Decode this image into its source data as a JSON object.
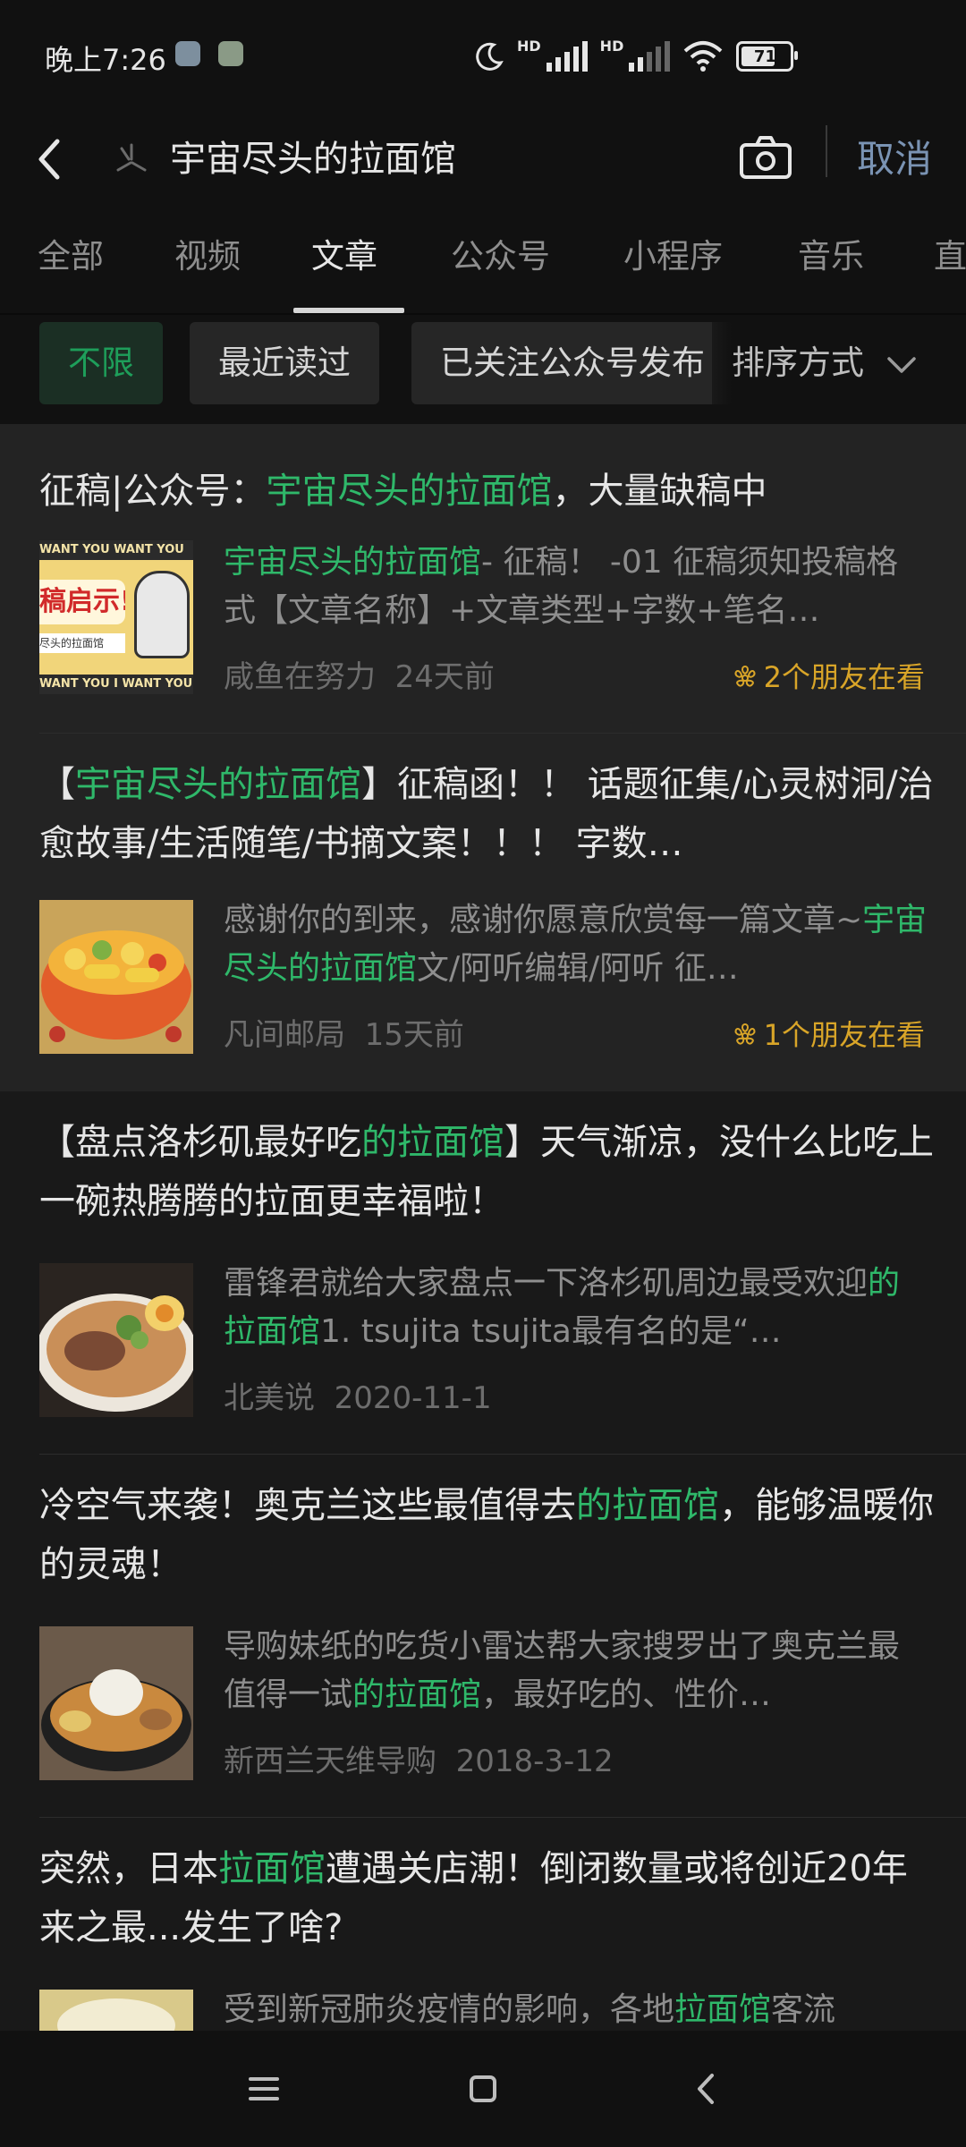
{
  "status_bar": {
    "time": "晚上7:26",
    "battery": "71",
    "battery_level": 0.71,
    "net_label": "HD"
  },
  "search": {
    "query": "宇宙尽头的拉面馆",
    "cancel": "取消"
  },
  "tabs": [
    "全部",
    "视频",
    "文章",
    "公众号",
    "小程序",
    "音乐",
    "直"
  ],
  "active_tab": "文章",
  "filters": {
    "chips": [
      "不限",
      "最近读过",
      "已关注公众号发布"
    ],
    "sort": "排序方式"
  },
  "articles": [
    {
      "title_parts": [
        {
          "t": "征稿|公众号：",
          "hl": false
        },
        {
          "t": "宇宙尽头的拉面馆",
          "hl": true
        },
        {
          "t": "，大量缺稿中",
          "hl": false
        }
      ],
      "snippet_parts": [
        {
          "t": "宇宙尽头的拉面馆",
          "hl": true
        },
        {
          "t": "- 征稿！ -01 征稿须知投稿格式【文章名称】+文章类型+字数+笔名…",
          "hl": false
        }
      ],
      "source": "咸鱼在努力",
      "time": "24天前",
      "friends": "2个朋友在看",
      "thumb_texts": [
        "WANT YOU  WANT YOU",
        "稿启示!",
        "尽头的拉面馆",
        "WANT YOU  I WANT YOU"
      ]
    },
    {
      "title_parts": [
        {
          "t": "【",
          "hl": false
        },
        {
          "t": "宇宙尽头的拉面馆",
          "hl": true
        },
        {
          "t": "】征稿函！！ 话题征集/心灵树洞/治愈故事/生活随笔/书摘文案！！！ 字数…",
          "hl": false
        }
      ],
      "snippet_parts": [
        {
          "t": "感谢你的到来，感谢你愿意欣赏每一篇文章~",
          "hl": false
        },
        {
          "t": "宇宙尽头的拉面馆",
          "hl": true
        },
        {
          "t": "文/阿听编辑/阿听 征…",
          "hl": false
        }
      ],
      "source": "凡间邮局",
      "time": "15天前",
      "friends": "1个朋友在看"
    },
    {
      "title_parts": [
        {
          "t": "【盘点洛杉矶最好吃",
          "hl": false
        },
        {
          "t": "的拉面馆",
          "hl": true
        },
        {
          "t": "】天气渐凉，没什么比吃上一碗热腾腾的拉面更幸福啦！",
          "hl": false
        }
      ],
      "snippet_parts": [
        {
          "t": "雷锋君就给大家盘点一下洛杉矶周边最受欢迎",
          "hl": false
        },
        {
          "t": "的拉面馆",
          "hl": true
        },
        {
          "t": "1. tsujita tsujita最有名的是“…",
          "hl": false
        }
      ],
      "source": "北美说",
      "time": "2020-11-1",
      "friends": ""
    },
    {
      "title_parts": [
        {
          "t": "冷空气来袭！奥克兰这些最值得去",
          "hl": false
        },
        {
          "t": "的拉面馆",
          "hl": true
        },
        {
          "t": "，能够温暖你的灵魂！",
          "hl": false
        }
      ],
      "snippet_parts": [
        {
          "t": "导购妹纸的吃货小雷达帮大家搜罗出了奥克兰最值得一试",
          "hl": false
        },
        {
          "t": "的拉面馆",
          "hl": true
        },
        {
          "t": "，最好吃的、性价…",
          "hl": false
        }
      ],
      "source": "新西兰天维导购",
      "time": "2018-3-12",
      "friends": ""
    },
    {
      "title_parts": [
        {
          "t": "突然，日本",
          "hl": false
        },
        {
          "t": "拉面馆",
          "hl": true
        },
        {
          "t": "遭遇关店潮！倒闭数量或将创近20年来之最...发生了啥?",
          "hl": false
        }
      ],
      "snippet_parts": [
        {
          "t": "受到新冠肺炎疫情的影响，各地",
          "hl": false
        },
        {
          "t": "拉面馆",
          "hl": true
        },
        {
          "t": "客流",
          "hl": false
        }
      ],
      "source": "",
      "time": "",
      "friends": ""
    }
  ],
  "colors": {
    "highlight": "#2fb86a",
    "friends": "#d9a528",
    "cancel": "#7a93b3"
  },
  "icons": [
    "back-arrow-icon",
    "sparkle-icon",
    "camera-icon",
    "chevron-down-icon",
    "flower-icon",
    "menu-icon",
    "home-square-icon",
    "back-chevron-icon"
  ]
}
